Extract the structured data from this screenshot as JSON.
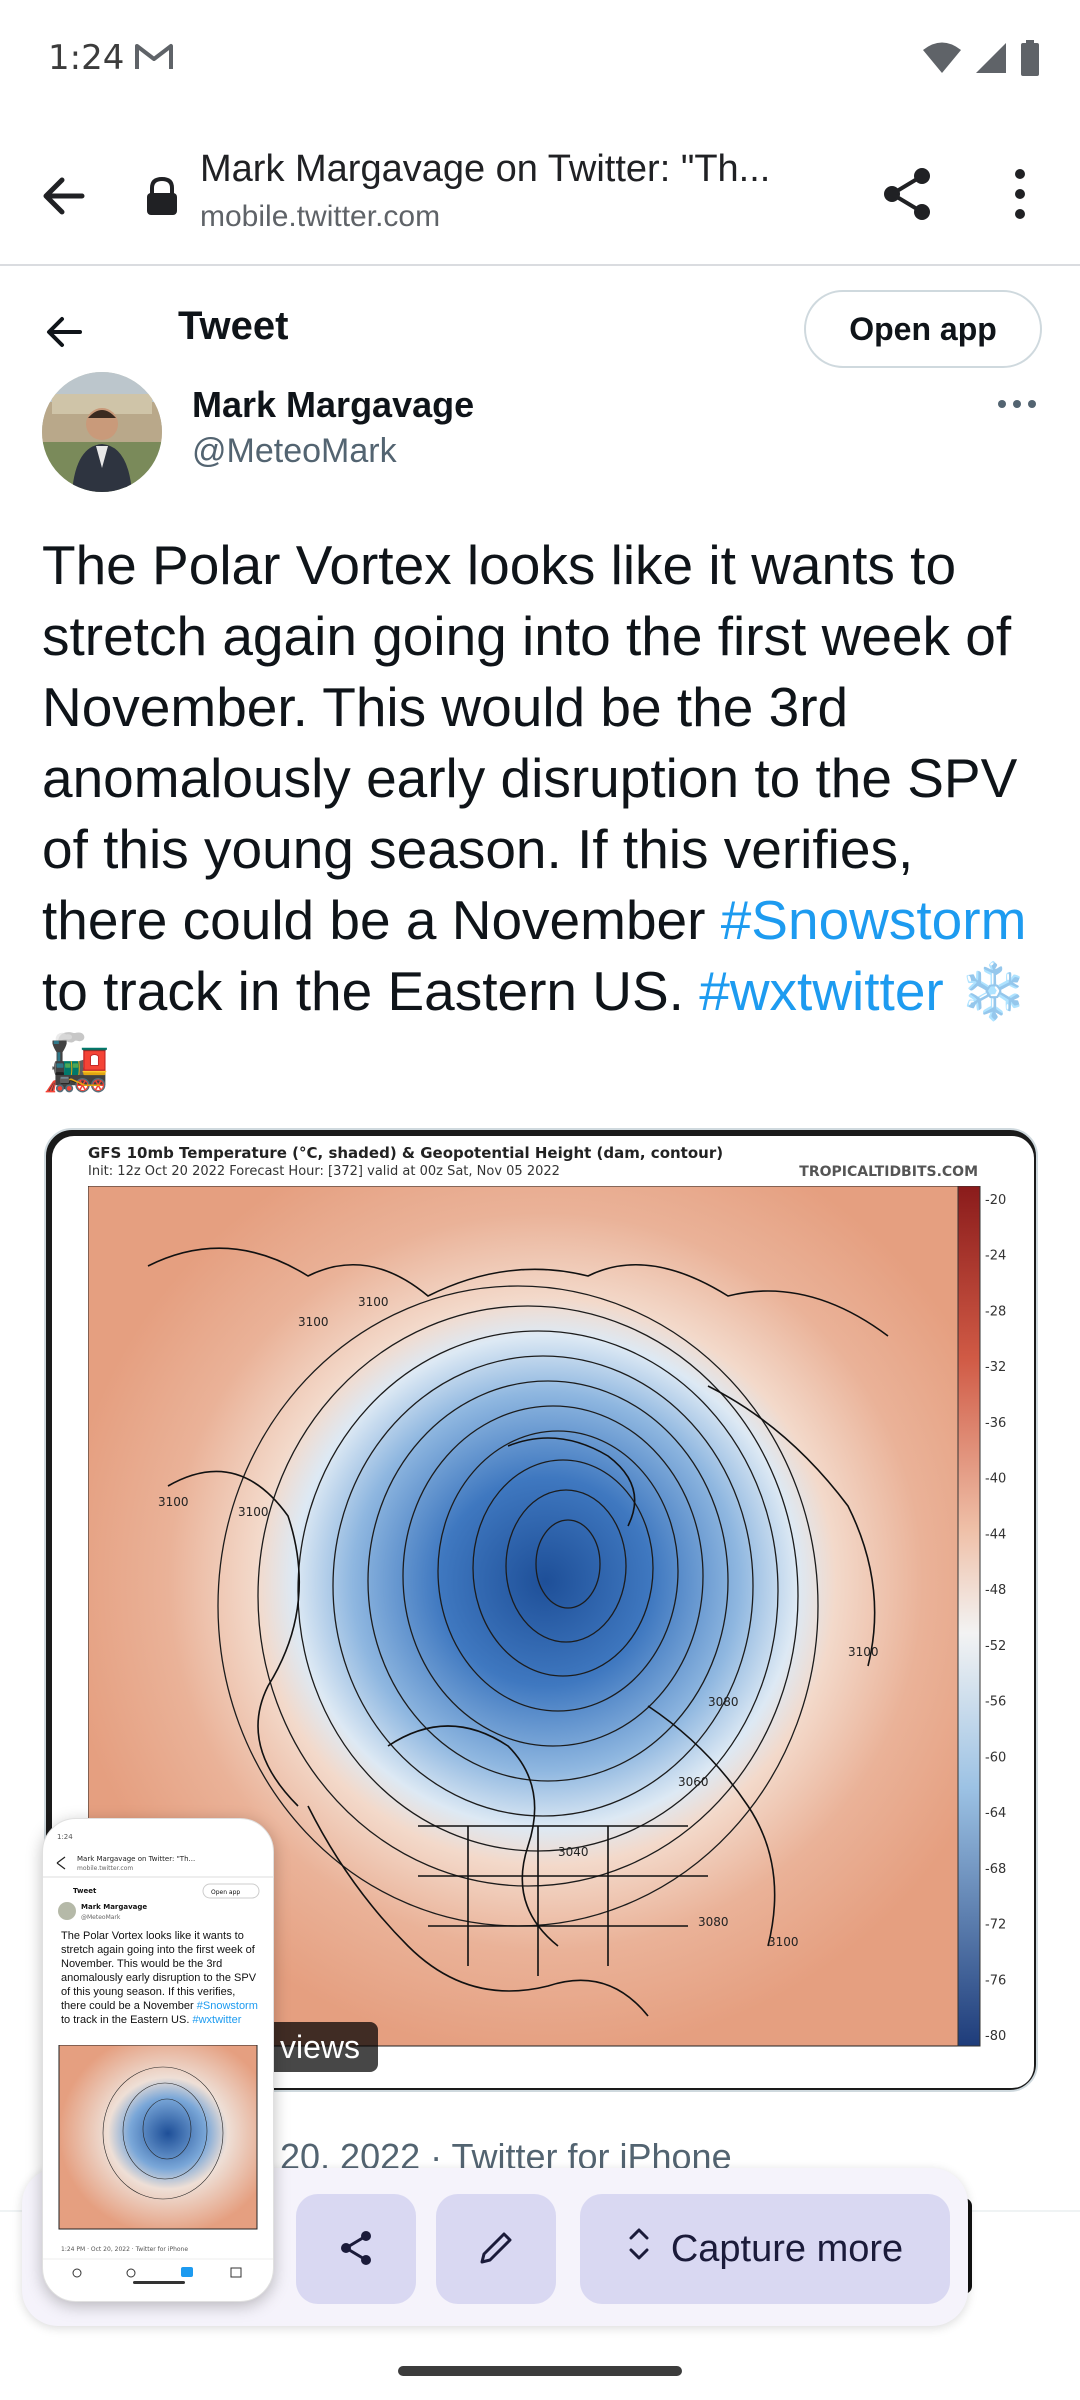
{
  "status_bar": {
    "time": "1:24",
    "icons": [
      "gmail-icon",
      "wifi-icon",
      "signal-icon",
      "battery-icon"
    ]
  },
  "browser": {
    "page_title": "Mark Margavage on Twitter: \"Th...",
    "domain": "mobile.twitter.com",
    "icons": [
      "back-arrow-icon",
      "lock-icon",
      "share-icon",
      "more-vert-icon"
    ]
  },
  "tweet_header": {
    "title": "Tweet",
    "open_app_label": "Open app"
  },
  "author": {
    "name": "Mark Margavage",
    "handle": "@MeteoMark"
  },
  "tweet": {
    "text_1": "The Polar Vortex looks like it wants to stretch again going into the first week of November. This would be the 3rd anomalously early disruption to the SPV of this young season. If this verifies, there could be a November ",
    "hashtag_1": "#Snowstorm",
    "text_2": " to track in the Eastern US. ",
    "hashtag_2": "#wxtwitter",
    "emoji": " ❄️🚂",
    "date_line": "20, 2022 · Twitter for iPhone",
    "views_label": "views"
  },
  "media": {
    "chart_title": "GFS 10mb Temperature (°C, shaded) & Geopotential Height (dam, contour)",
    "chart_subtitle": "Init: 12z Oct 20 2022   Forecast Hour: [372]   valid at 00z Sat, Nov 05 2022",
    "credit": "TROPICALTIDBITS.COM",
    "colorbar_ticks": [
      "-20",
      "-24",
      "-28",
      "-32",
      "-36",
      "-40",
      "-44",
      "-48",
      "-52",
      "-56",
      "-60",
      "-64",
      "-68",
      "-72",
      "-76",
      "-80"
    ],
    "contour_labels": [
      "3100",
      "3100",
      "3100",
      "3100",
      "3080",
      "3060",
      "3040",
      "3100",
      "3080",
      "3100"
    ]
  },
  "capture_toolbar": {
    "capture_more_label": "Capture more",
    "icons": [
      "share-icon",
      "edit-pencil-icon",
      "expand-vertical-icon"
    ]
  },
  "thumbnail": {
    "title_line": "Mark Margavage on Twitter: \"Th...",
    "domain": "mobile.twitter.com",
    "tweet_label": "Tweet",
    "open_app": "Open app",
    "author": "Mark Margavage",
    "handle": "@MeteoMark",
    "date_line": "1:24 PM · Oct 20, 2022 · Twitter for iPhone"
  },
  "colors": {
    "hashtag": "#1d9bf0",
    "text": "#0f1419",
    "secondary": "#536471",
    "capture_button": "#d9d8f2"
  }
}
